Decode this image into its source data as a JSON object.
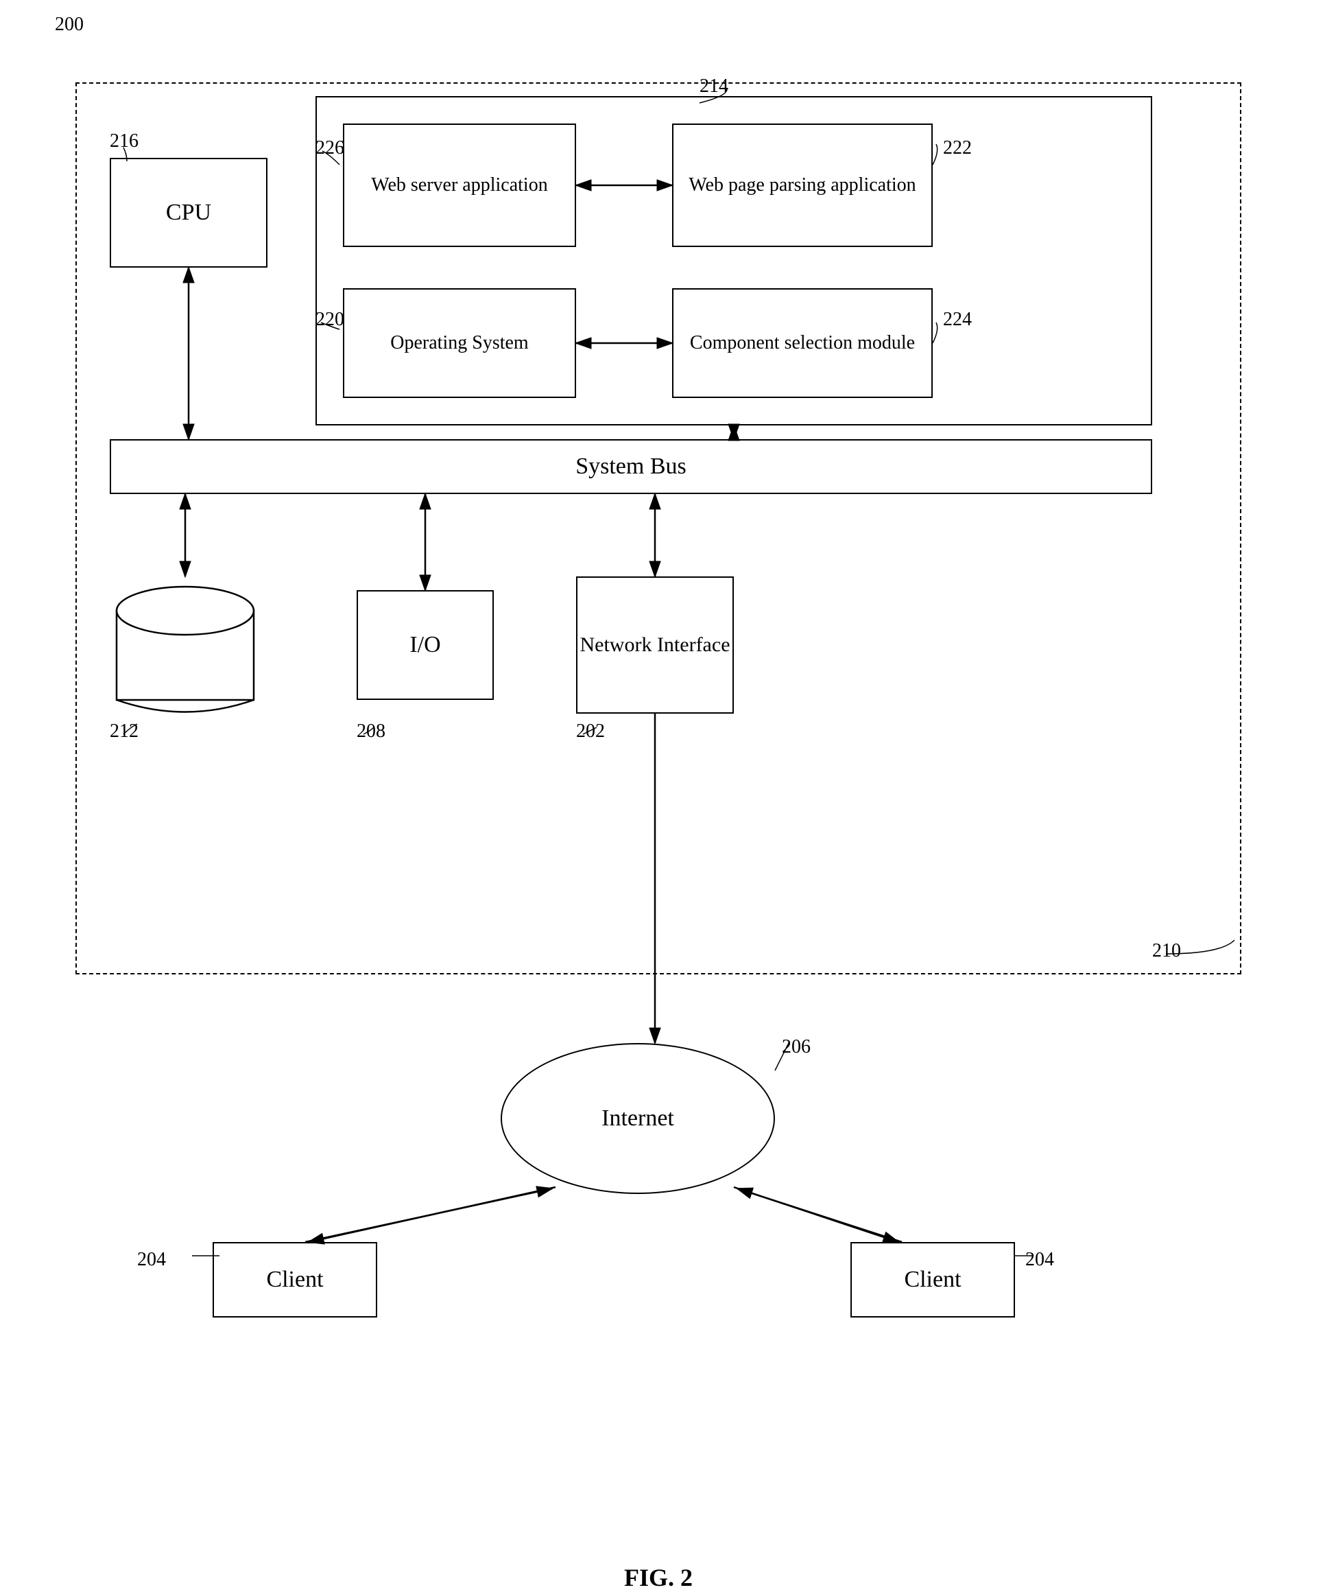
{
  "diagram": {
    "fig_label": "FIG. 2",
    "ref_numbers": {
      "r200": "200",
      "r202": "202",
      "r204a": "204",
      "r204b": "204",
      "r206": "206",
      "r208": "208",
      "r210": "210",
      "r212": "212",
      "r214": "214",
      "r216": "216",
      "r220": "220",
      "r222": "222",
      "r224": "224",
      "r226": "226"
    },
    "modules": {
      "web_server": "Web server application",
      "web_page_parsing": "Web page parsing application",
      "operating_system": "Operating System",
      "component_selection": "Component selection module",
      "cpu": "CPU",
      "system_bus": "System Bus",
      "io": "I/O",
      "network_interface": "Network Interface",
      "internet": "Internet",
      "client": "Client"
    }
  }
}
